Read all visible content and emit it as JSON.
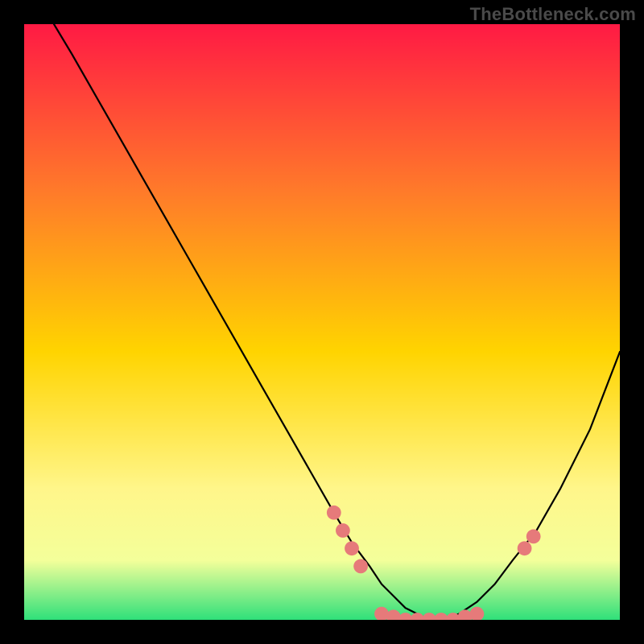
{
  "watermark": "TheBottleneck.com",
  "chart_data": {
    "type": "line",
    "title": "",
    "xlabel": "",
    "ylabel": "",
    "xlim": [
      0,
      100
    ],
    "ylim": [
      0,
      100
    ],
    "grid": false,
    "legend": false,
    "background_gradient": {
      "top": "#ff1a44",
      "mid_upper": "#ff7a2a",
      "mid": "#ffd400",
      "mid_lower": "#fff68a",
      "low_band": "#f4ff9a",
      "bottom": "#2fe07a"
    },
    "series": [
      {
        "name": "bottleneck-curve",
        "color": "#000000",
        "x": [
          5,
          8,
          12,
          16,
          20,
          24,
          28,
          32,
          36,
          40,
          44,
          48,
          52,
          55,
          58,
          60,
          62,
          64,
          66,
          68,
          70,
          73,
          76,
          79,
          82,
          86,
          90,
          95,
          100
        ],
        "y": [
          100,
          95,
          88,
          81,
          74,
          67,
          60,
          53,
          46,
          39,
          32,
          25,
          18,
          13,
          9,
          6,
          4,
          2,
          1,
          0,
          0,
          1,
          3,
          6,
          10,
          15,
          22,
          32,
          45
        ]
      }
    ],
    "markers": {
      "name": "highlighted-points",
      "color": "#e67a7a",
      "radius_relative": 1.2,
      "points": [
        {
          "x": 52,
          "y": 18
        },
        {
          "x": 53.5,
          "y": 15
        },
        {
          "x": 55,
          "y": 12
        },
        {
          "x": 56.5,
          "y": 9
        },
        {
          "x": 60,
          "y": 1
        },
        {
          "x": 62,
          "y": 0.5
        },
        {
          "x": 64,
          "y": 0
        },
        {
          "x": 66,
          "y": 0
        },
        {
          "x": 68,
          "y": 0
        },
        {
          "x": 70,
          "y": 0
        },
        {
          "x": 72,
          "y": 0
        },
        {
          "x": 74,
          "y": 0.5
        },
        {
          "x": 76,
          "y": 1
        },
        {
          "x": 84,
          "y": 12
        },
        {
          "x": 85.5,
          "y": 14
        }
      ]
    }
  }
}
